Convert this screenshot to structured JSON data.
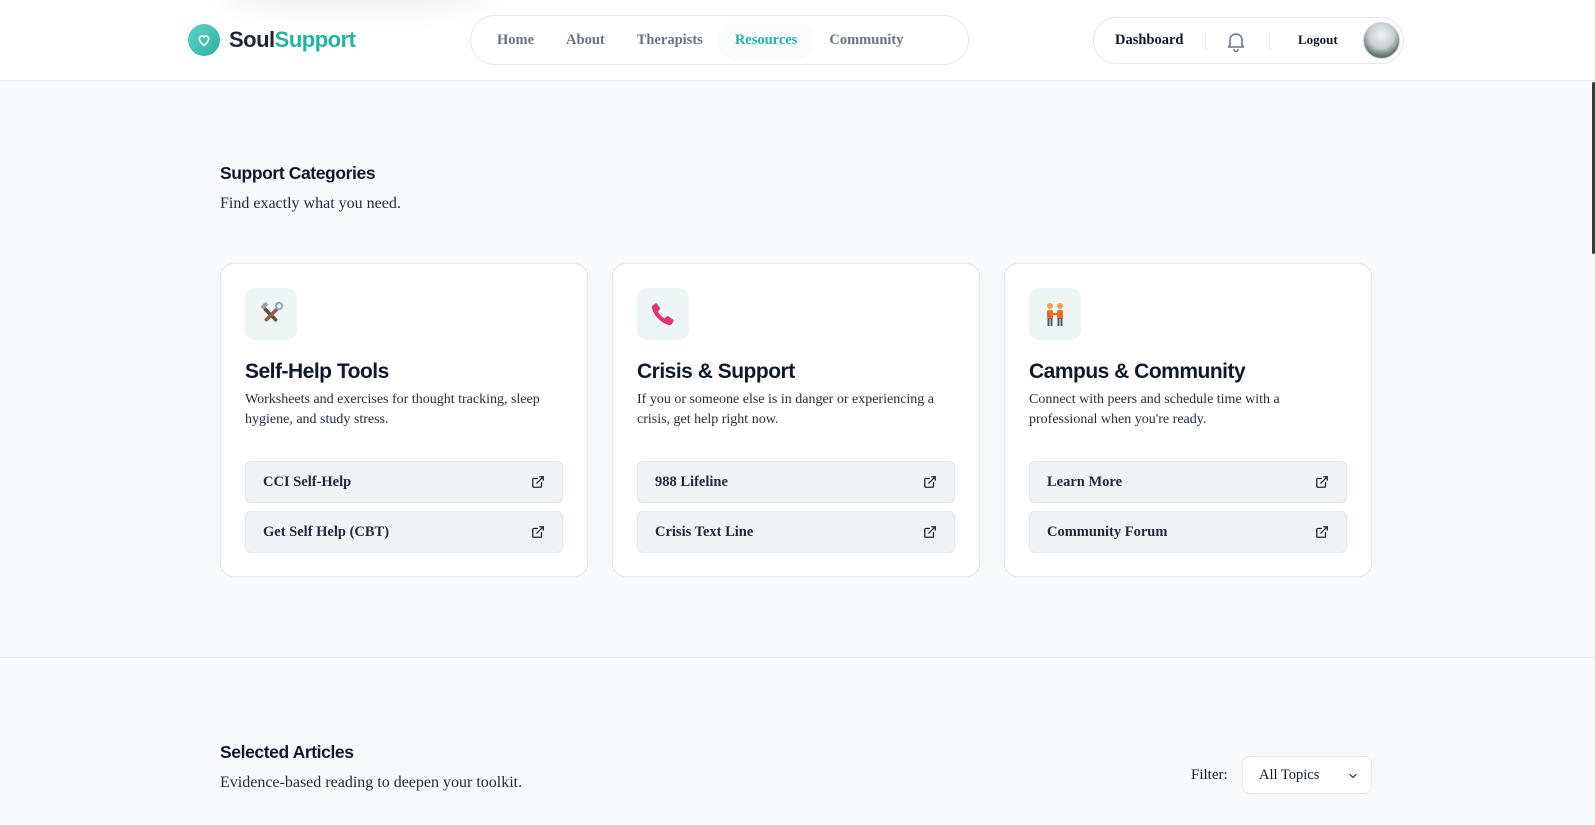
{
  "brand": {
    "name_a": "Soul",
    "name_b": "Support",
    "accent": "#22b3a1"
  },
  "nav": {
    "items": [
      {
        "label": "Home"
      },
      {
        "label": "About"
      },
      {
        "label": "Therapists"
      },
      {
        "label": "Resources",
        "active": true
      },
      {
        "label": "Community"
      }
    ]
  },
  "user": {
    "dashboard": "Dashboard",
    "logout": "Logout",
    "bell_icon": "bell-icon"
  },
  "support": {
    "title": "Support Categories",
    "subtitle": "Find exactly what you need.",
    "cards": [
      {
        "icon": "tools-icon",
        "title": "Self-Help Tools",
        "desc": "Worksheets and exercises for thought tracking, sleep hygiene, and study stress.",
        "buttons": [
          {
            "label": "CCI Self-Help"
          },
          {
            "label": "Get Self Help (CBT)"
          }
        ]
      },
      {
        "icon": "phone-icon",
        "title": "Crisis & Support",
        "desc": "If you or someone else is in danger or experiencing a crisis, get help right now.",
        "buttons": [
          {
            "label": "988 Lifeline"
          },
          {
            "label": "Crisis Text Line"
          }
        ]
      },
      {
        "icon": "people-icon",
        "title": "Campus & Community",
        "desc": "Connect with peers and schedule time with a professional when you're ready.",
        "buttons": [
          {
            "label": "Learn More"
          },
          {
            "label": "Community Forum"
          }
        ]
      }
    ]
  },
  "articles": {
    "title": "Selected Articles",
    "subtitle": "Evidence-based reading to deepen your toolkit.",
    "filter_label": "Filter:",
    "filter_value": "All Topics"
  }
}
